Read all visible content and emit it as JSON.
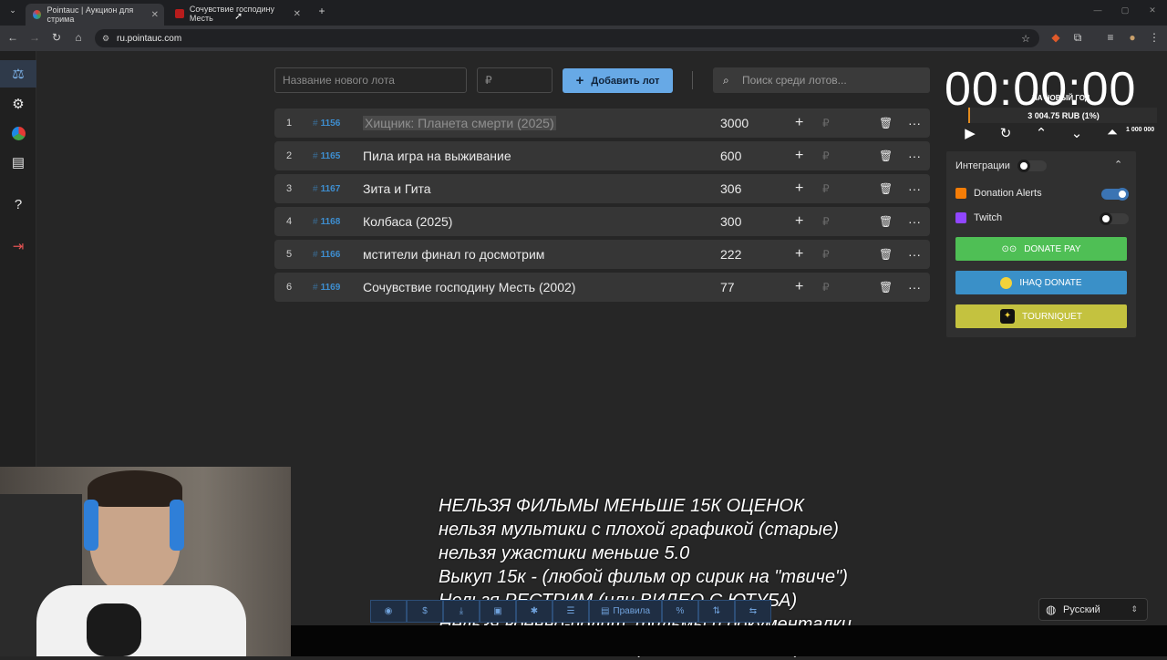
{
  "browser": {
    "tabs": [
      {
        "title": "Pointauc | Аукцион для стрима",
        "active": true
      },
      {
        "title": "Сочувствие господину Месть",
        "active": false
      }
    ],
    "url": "ru.pointauc.com"
  },
  "sidebar": {
    "items": [
      "auction-icon",
      "gear-icon",
      "pie-chart-icon",
      "clipboard-icon",
      "help-icon",
      "logout-icon"
    ]
  },
  "toolbar": {
    "new_lot_placeholder": "Название нового лота",
    "amount_placeholder": "₽",
    "add_lot_label": "Добавить лот",
    "search_placeholder": "Поиск среди лотов..."
  },
  "lots": [
    {
      "index": "1",
      "id": "1156",
      "name": "Хищник: Планета смерти (2025)",
      "amount": "3000"
    },
    {
      "index": "2",
      "id": "1165",
      "name": "Пила игра на выживание",
      "amount": "600"
    },
    {
      "index": "3",
      "id": "1167",
      "name": "Зита и Гита",
      "amount": "306"
    },
    {
      "index": "4",
      "id": "1168",
      "name": "Колбаса (2025)",
      "amount": "300"
    },
    {
      "index": "5",
      "id": "1166",
      "name": "мстители финал го досмотрим",
      "amount": "222"
    },
    {
      "index": "6",
      "id": "1169",
      "name": "Сочувствие господину Месть (2002)",
      "amount": "77"
    }
  ],
  "lot_row_icons": {
    "hash": "#",
    "plus": "+",
    "rub": "₽",
    "more": "···"
  },
  "timer": {
    "value": "00:00:00",
    "goal_label": "НА НОВЫЙ ГОД",
    "goal_amount": "3 004.75 RUB (1%)",
    "goal_progress_percent": 1,
    "goal_max": "1 000 000"
  },
  "integrations": {
    "title": "Интеграции",
    "items": [
      {
        "name": "Donation Alerts",
        "enabled": true,
        "color": "#f57d07"
      },
      {
        "name": "Twitch",
        "enabled": false,
        "color": "#9146ff"
      }
    ],
    "buttons": [
      {
        "label": "DONATE PAY",
        "color": "#4fbf55"
      },
      {
        "label": "IHAQ DONATE",
        "color": "#3a90c8"
      },
      {
        "label": "TOURNIQUET",
        "color": "#c4c23f"
      }
    ]
  },
  "overlay": {
    "lines": [
      "НЕЛЬЗЯ ФИЛЬМЫ МЕНЬШЕ 15К ОЦЕНОК",
      "нельзя мультики с плохой графикой (старые)",
      "нельзя ужастики меньше 5.0",
      "Выкуп 15к - (любой фильм ор сирик на \"твиче\")",
      "Нельзя РЕСТРИМ (или ВИДЕО С ЮТУБА)",
      "Нельзя военно-полит. фильмы и документалки",
      "БЕЗ ТРЭША И ФИГНИ (МОГУ СКИПНУТЬ)"
    ]
  },
  "bottom_tools": {
    "rules_label": "Правила"
  },
  "language": {
    "selected": "Русский"
  }
}
